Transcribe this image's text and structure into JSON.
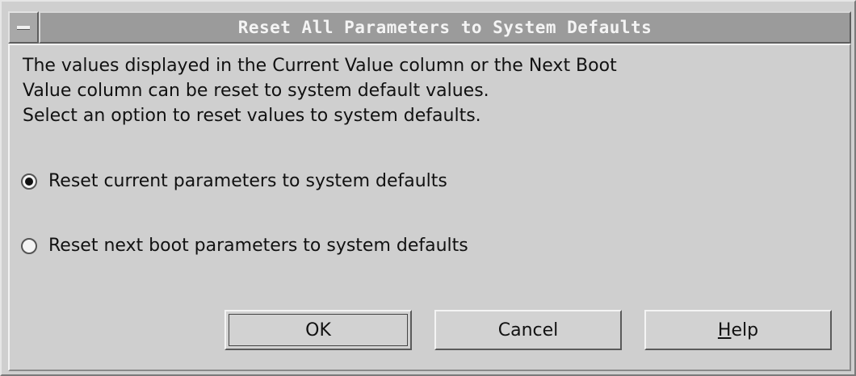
{
  "window": {
    "title": "Reset All Parameters to System Defaults"
  },
  "description": {
    "line1": "The values displayed in the Current Value column or the Next Boot",
    "line2": "Value column can be reset to system default values.",
    "line3": "Select an option to reset values to system defaults."
  },
  "options": [
    {
      "label": "Reset current parameters to system defaults",
      "selected": true
    },
    {
      "label": "Reset next boot parameters to system defaults",
      "selected": false
    }
  ],
  "buttons": {
    "ok_label": "OK",
    "cancel_label": "Cancel",
    "help_mnemonic": "H",
    "help_rest": "elp"
  }
}
